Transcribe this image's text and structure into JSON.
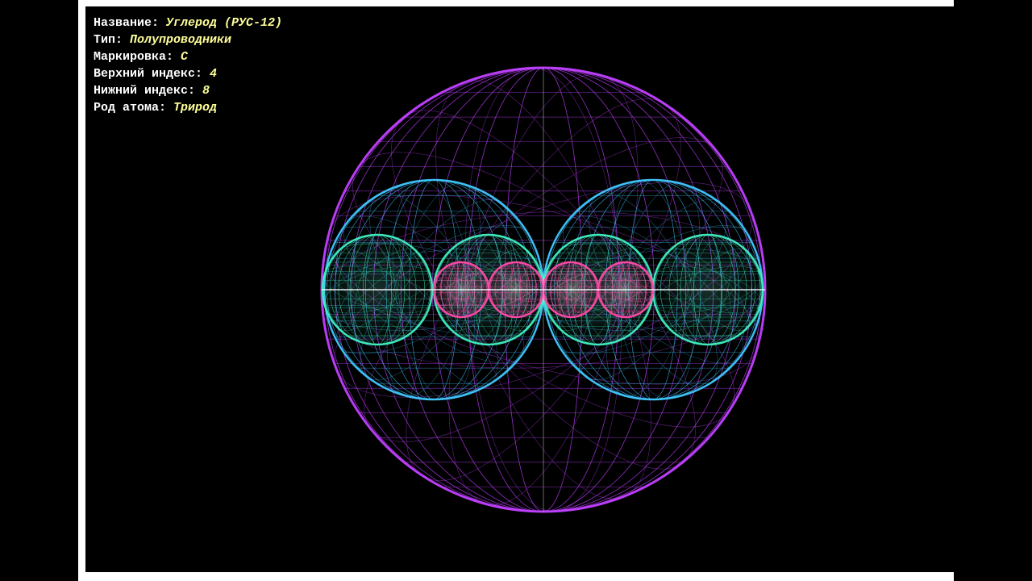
{
  "window": {
    "background": "#000000",
    "frame_color": "#ffffff"
  },
  "info": {
    "rows": [
      {
        "label": "Название: ",
        "value": "Углерод (РУС-12)"
      },
      {
        "label": "Тип: ",
        "value": "Полупроводники"
      },
      {
        "label": "Маркировка: ",
        "value": "C"
      },
      {
        "label": "Верхний индекс: ",
        "value": "4"
      },
      {
        "label": "Нижний индекс: ",
        "value": "8"
      },
      {
        "label": "Род атома: ",
        "value": "Трирод"
      }
    ],
    "label_color": "#ffffff",
    "value_color": "#ffff99"
  },
  "scene": {
    "colors": {
      "outer": "#c040ff",
      "middle": "#40c8ff",
      "inner_green": "#40f0c0",
      "core_pink": "#ff4aa8",
      "axis": "#ffffff"
    }
  }
}
